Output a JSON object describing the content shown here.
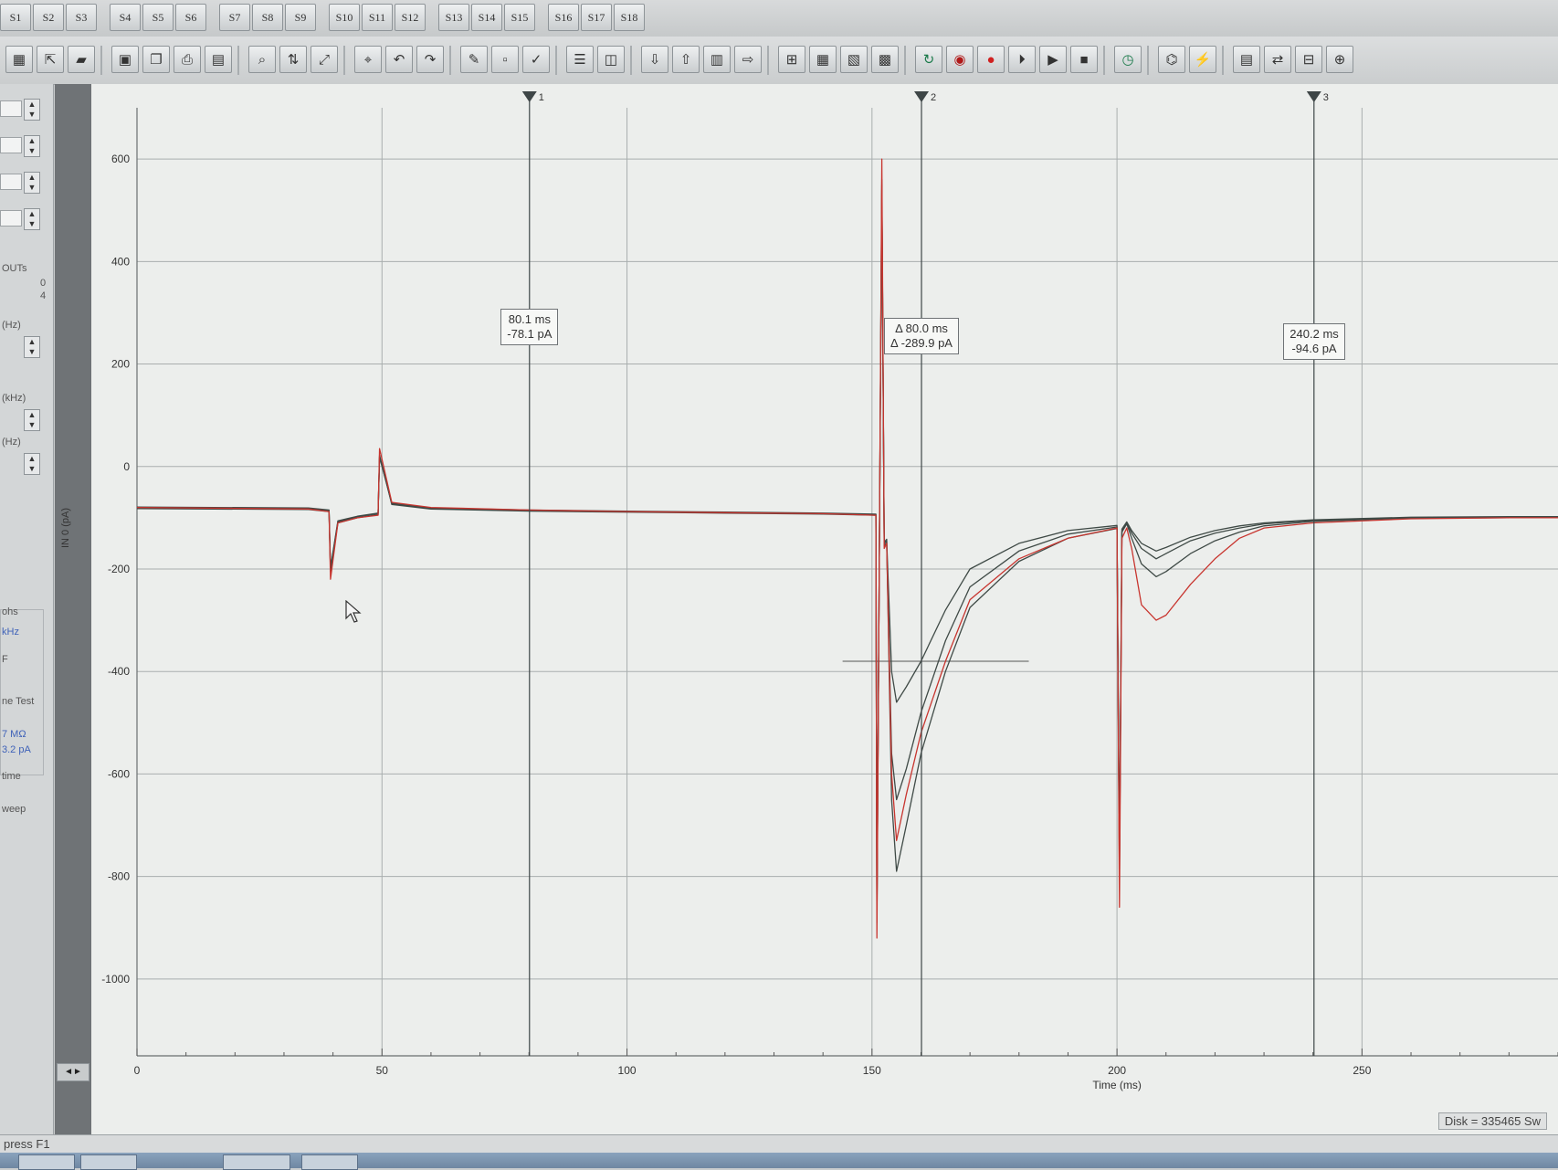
{
  "toolbar_top": {
    "buttons": [
      "S1",
      "S2",
      "S3",
      "S4",
      "S5",
      "S6",
      "S7",
      "S8",
      "S9",
      "S10",
      "S11",
      "S12",
      "S13",
      "S14",
      "S15",
      "S16",
      "S17",
      "S18"
    ]
  },
  "toolbar_main": {
    "icons": [
      "layout-icon",
      "open-icon",
      "folder-icon",
      "save-icon",
      "copy-icon",
      "print-icon",
      "preview-icon",
      "zoom-icon",
      "scale-icon",
      "fit-icon",
      "cursor-mode-icon",
      "undo-icon",
      "redo-icon",
      "edit-icon",
      "window-icon",
      "check-icon",
      "split-horizontal-icon",
      "split-vertical-icon",
      "load-protocol-icon",
      "save-protocol-icon",
      "save-data-icon",
      "export-icon",
      "analysis-icon",
      "table-icon",
      "results-icon",
      "grid-icon",
      "loop-icon",
      "record-circle-icon",
      "record-icon",
      "step-play-icon",
      "play-icon",
      "stop-icon",
      "timer-icon",
      "chip-icon",
      "membrane-icon",
      "lock-icon",
      "link-icon",
      "zoom-out-icon",
      "scope-icon"
    ]
  },
  "left_panel": {
    "labels": [
      "OUTs",
      "0",
      "4",
      "(Hz)",
      "(kHz)",
      "(Hz)",
      "ohs",
      "kHz",
      "F",
      "ne Test",
      "7 MΩ",
      "3.2 pA",
      "time",
      "weep"
    ]
  },
  "y_axis": {
    "label": "IN 0 (pA)"
  },
  "cursor_readouts": [
    {
      "line1": "80.1 ms",
      "line2": "-78.1 pA"
    },
    {
      "line1": "Δ 80.0 ms",
      "line2": "Δ -289.9 pA"
    },
    {
      "line1": "240.2 ms",
      "line2": "-94.6 pA"
    }
  ],
  "status": {
    "help_text": "press F1",
    "disk_text": "Disk = 335465 Sw"
  },
  "chart_data": {
    "type": "line",
    "xlabel": "Time (ms)",
    "ylabel": "IN 0 (pA)",
    "xlim": [
      0,
      290
    ],
    "ylim": [
      -1150,
      700
    ],
    "x_ticks": [
      0,
      50,
      100,
      150,
      200,
      250
    ],
    "y_ticks": [
      600,
      400,
      200,
      0,
      -200,
      -400,
      -600,
      -800,
      -1000
    ],
    "cursors": [
      {
        "label": "1",
        "x": 80.1
      },
      {
        "label": "2",
        "x": 160.1
      },
      {
        "label": "3",
        "x": 240.2
      }
    ],
    "series": [
      {
        "color": "#c8352f",
        "x": [
          0,
          35,
          39.2,
          39.5,
          41,
          45,
          49.2,
          49.5,
          52,
          60,
          80,
          100,
          120,
          140,
          150.8,
          151,
          152,
          152.5,
          153,
          154,
          155,
          157,
          160,
          165,
          170,
          180,
          190,
          200,
          200.5,
          201,
          202,
          203,
          205,
          208,
          210,
          215,
          220,
          225,
          230,
          240,
          260,
          280,
          290
        ],
        "y": [
          -80,
          -83,
          -88,
          -220,
          -110,
          -100,
          -95,
          35,
          -70,
          -80,
          -85,
          -88,
          -90,
          -92,
          -95,
          -920,
          600,
          -160,
          -150,
          -600,
          -730,
          -640,
          -520,
          -380,
          -260,
          -180,
          -140,
          -120,
          -860,
          -140,
          -120,
          -160,
          -270,
          -300,
          -290,
          -230,
          -180,
          -140,
          -120,
          -110,
          -102,
          -100,
          -100
        ]
      },
      {
        "color": "#3f4a46",
        "x": [
          0,
          35,
          39.2,
          39.5,
          41,
          45,
          49.2,
          49.5,
          52,
          60,
          80,
          100,
          120,
          140,
          150.8,
          151,
          152,
          152.5,
          153,
          154,
          155,
          157,
          160,
          165,
          170,
          180,
          190,
          200,
          200.5,
          201,
          202,
          203,
          205,
          208,
          210,
          215,
          220,
          225,
          230,
          240,
          260,
          280,
          290
        ],
        "y": [
          -80,
          -82,
          -86,
          -200,
          -108,
          -98,
          -92,
          20,
          -72,
          -82,
          -86,
          -88,
          -90,
          -92,
          -94,
          -880,
          550,
          -150,
          -145,
          -400,
          -460,
          -430,
          -380,
          -280,
          -200,
          -150,
          -125,
          -115,
          -780,
          -125,
          -110,
          -130,
          -160,
          -180,
          -170,
          -145,
          -130,
          -120,
          -112,
          -105,
          -100,
          -99,
          -99
        ]
      },
      {
        "color": "#3f4a46",
        "x": [
          0,
          35,
          39.2,
          39.5,
          41,
          45,
          49.2,
          49.5,
          52,
          60,
          80,
          100,
          120,
          140,
          150.8,
          151,
          152,
          152.5,
          153,
          154,
          155,
          157,
          160,
          165,
          170,
          180,
          190,
          200,
          200.5,
          201,
          202,
          203,
          205,
          208,
          210,
          215,
          220,
          225,
          230,
          240,
          260,
          280,
          290
        ],
        "y": [
          -82,
          -84,
          -88,
          -205,
          -110,
          -100,
          -94,
          22,
          -74,
          -83,
          -87,
          -89,
          -91,
          -93,
          -95,
          -890,
          560,
          -155,
          -148,
          -560,
          -650,
          -590,
          -480,
          -340,
          -235,
          -165,
          -132,
          -118,
          -800,
          -128,
          -112,
          -140,
          -190,
          -215,
          -205,
          -170,
          -145,
          -128,
          -116,
          -107,
          -101,
          -100,
          -100
        ]
      },
      {
        "color": "#3f4a46",
        "x": [
          0,
          35,
          39.2,
          39.5,
          41,
          45,
          49.2,
          49.5,
          52,
          60,
          80,
          100,
          120,
          140,
          150.8,
          151,
          152,
          152.5,
          153,
          154,
          155,
          157,
          160,
          165,
          170,
          180,
          190,
          200,
          200.5,
          201,
          202,
          203,
          205,
          208,
          210,
          215,
          220,
          225,
          230,
          240,
          260,
          280,
          290
        ],
        "y": [
          -79,
          -81,
          -85,
          -198,
          -106,
          -97,
          -91,
          18,
          -71,
          -81,
          -85,
          -87,
          -89,
          -91,
          -93,
          -870,
          540,
          -148,
          -142,
          -650,
          -790,
          -700,
          -560,
          -400,
          -275,
          -185,
          -140,
          -121,
          -770,
          -122,
          -108,
          -125,
          -150,
          -165,
          -158,
          -138,
          -125,
          -116,
          -110,
          -104,
          -99,
          -98,
          -98
        ]
      }
    ]
  }
}
